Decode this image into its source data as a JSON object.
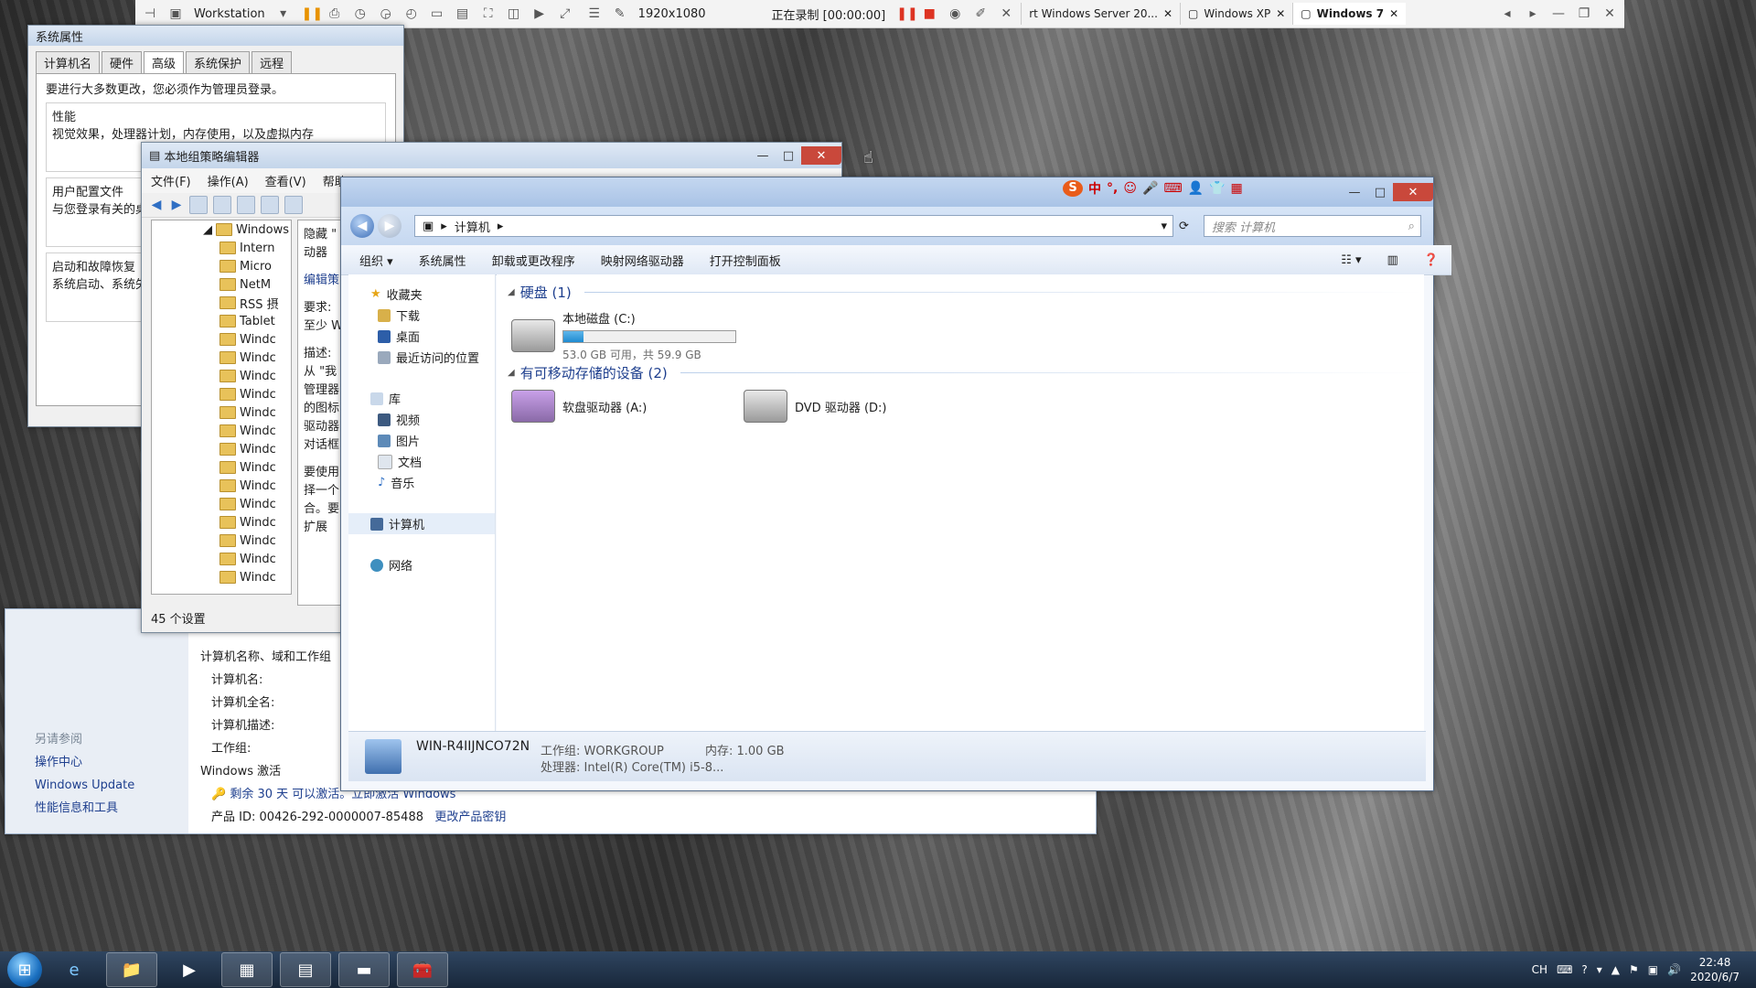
{
  "vmware": {
    "app": "Workstation",
    "resolution": "1920x1080",
    "recording": "正在录制 [00:00:00]",
    "tabs": [
      {
        "label": "rt Windows Server 20...",
        "active": false
      },
      {
        "label": "Windows XP",
        "active": false
      },
      {
        "label": "Windows 7",
        "active": true
      }
    ]
  },
  "sysprop": {
    "title": "系统属性",
    "tabs": [
      "计算机名",
      "硬件",
      "高级",
      "系统保护",
      "远程"
    ],
    "selected_tab": "高级",
    "admin_note": "要进行大多数更改，您必须作为管理员登录。",
    "perf_title": "性能",
    "perf_text": "视觉效果，处理器计划，内存使用，以及虚拟内存",
    "profile_title": "用户配置文件",
    "profile_text": "与您登录有关的桌",
    "startup_title": "启动和故障恢复",
    "startup_text": "系统启动、系统失"
  },
  "gpedit": {
    "title": "本地组策略编辑器",
    "menu": [
      "文件(F)",
      "操作(A)",
      "查看(V)",
      "帮助(H)"
    ],
    "tree_root": "Windows",
    "tree": [
      "Intern",
      "Micro",
      "NetM",
      "RSS 摂",
      "Tablet",
      "Windc",
      "Windc",
      "Windc",
      "Windc",
      "Windc",
      "Windc",
      "Windc",
      "Windc",
      "Windc",
      "Windc",
      "Windc",
      "Windc",
      "Windc",
      "Windc"
    ],
    "desc_lines": [
      "隐藏 \"",
      "动器",
      "",
      "编辑策",
      "",
      "要求:",
      "至少 W",
      "",
      "描述:",
      "从 \"我",
      "管理器",
      "的图标",
      "驱动器",
      "对话框",
      "",
      "要使用",
      "择一个",
      "合。要"
    ],
    "tab_label": "扩展",
    "status": "45 个设置"
  },
  "sysinfo": {
    "see_also": "另请参阅",
    "links": [
      "操作中心",
      "Windows Update",
      "性能信息和工具"
    ],
    "section_title": "计算机名称、域和工作组",
    "rows": [
      "计算机名:",
      "计算机全名:",
      "计算机描述:",
      "工作组:"
    ],
    "activation_title": "Windows 激活",
    "activation_text": "剩余 30 天 可以激活。立即激活 Windows",
    "product_id": "产品 ID: 00426-292-0000007-85488",
    "change_key": "更改产品密钥"
  },
  "explorer": {
    "breadcrumb": "计算机",
    "search_placeholder": "搜索 计算机",
    "commands": [
      "组织 ▾",
      "系统属性",
      "卸载或更改程序",
      "映射网络驱动器",
      "打开控制面板"
    ],
    "nav": {
      "favorites": "收藏夹",
      "fav_items": [
        "下载",
        "桌面",
        "最近访问的位置"
      ],
      "libraries": "库",
      "lib_items": [
        "视频",
        "图片",
        "文档",
        "音乐"
      ],
      "computer": "计算机",
      "network": "网络"
    },
    "hdd_section": "硬盘 (1)",
    "hdd": {
      "name": "本地磁盘 (C:)",
      "free": "53.0 GB 可用，共 59.9 GB",
      "used_fraction": 0.115
    },
    "removable_section": "有可移动存储的设备 (2)",
    "floppy": "软盘驱动器 (A:)",
    "dvd": "DVD 驱动器 (D:)",
    "details": {
      "computer_name": "WIN-R4IIJNCO72N",
      "workgroup": "工作组: WORKGROUP",
      "memory": "内存: 1.00 GB",
      "processor": "处理器: Intel(R) Core(TM) i5-8..."
    }
  },
  "sogou": [
    "中",
    "°,",
    "☺",
    "🎤",
    "⌨",
    "👤",
    "👕",
    "▦"
  ],
  "taskbar": {
    "lang": "CH",
    "time": "22:48",
    "date": "2020/6/7"
  }
}
